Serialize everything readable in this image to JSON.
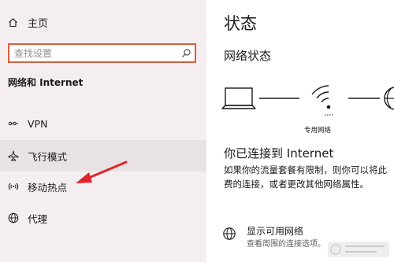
{
  "sidebar": {
    "home_label": "主页",
    "search_placeholder": "查找设置",
    "section_heading": "网络和 Internet",
    "items": [
      {
        "label": "VPN",
        "icon": "vpn-icon"
      },
      {
        "label": "飞行模式",
        "icon": "airplane-icon"
      },
      {
        "label": "移动热点",
        "icon": "hotspot-icon"
      },
      {
        "label": "代理",
        "icon": "globe-icon"
      }
    ]
  },
  "main": {
    "title": "状态",
    "network_status_heading": "网络状态",
    "diagram": {
      "network_label": "专用网络"
    },
    "connected_heading": "你已连接到 Internet",
    "description_lines": [
      "如果你的流量套餐有限制，则你可以将此",
      "费的连接，或者更改其他网络属性。"
    ],
    "show_networks": {
      "title": "显示可用网络",
      "subtitle": "查看周围的连接选项。"
    }
  },
  "colors": {
    "sidebar_bg": "#f5eef1",
    "search_border": "#d55f3c",
    "selected_bg": "#e8e2e5",
    "annotation_arrow": "#e0252b"
  }
}
